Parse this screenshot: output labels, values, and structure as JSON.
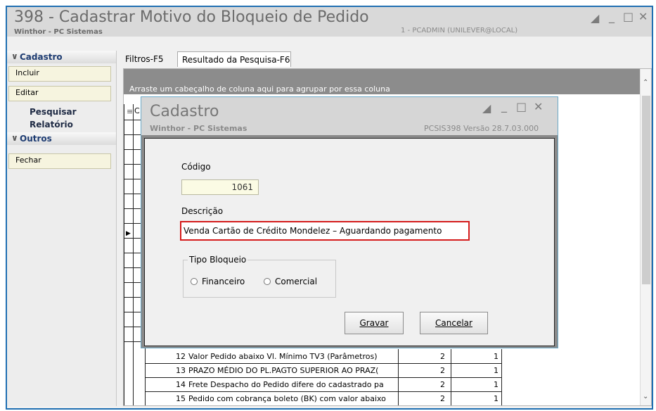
{
  "window": {
    "title": "398 - Cadastrar Motivo do Bloqueio de Pedido",
    "subtitle": "Winthor - PC Sistemas",
    "user_info": "1 - PCADMIN (UNILEVER@LOCAL)"
  },
  "sidebar": {
    "cadastro_header": "Cadastro",
    "incluir": "Incluir",
    "editar": "Editar",
    "pesquisar": "Pesquisar",
    "relatorio": "Relatório",
    "outros_header": "Outros",
    "fechar": "Fechar"
  },
  "tabs": {
    "filtros": "Filtros-F5",
    "resultado": "Resultado da Pesquisa-F6"
  },
  "grid": {
    "group_hint": "Arraste um cabeçalho de coluna aqui para agrupar por essa coluna",
    "rows": [
      {
        "code": "12",
        "desc": "Valor Pedido abaixo Vl. Mínimo TV3 (Parâmetros)",
        "col3": "2",
        "col4": "1"
      },
      {
        "code": "13",
        "desc": "PRAZO MÉDIO DO PL.PAGTO SUPERIOR AO PRAZ(",
        "col3": "2",
        "col4": "1"
      },
      {
        "code": "14",
        "desc": "Frete Despacho do Pedido difere do cadastrado pa",
        "col3": "2",
        "col4": "1"
      },
      {
        "code": "15",
        "desc": "Pedido com cobrança boleto (BK) com valor abaixo",
        "col3": "2",
        "col4": "1"
      }
    ]
  },
  "dialog": {
    "title": "Cadastro",
    "subtitle": "Winthor - PC Sistemas",
    "version": "PCSIS398  Versão  28.7.03.000",
    "codigo_label": "Código",
    "codigo_value": "1061",
    "descricao_label": "Descrição",
    "descricao_value": "Venda Cartão de Crédito Mondelez – Aguardando pagamento",
    "tipo_label": "Tipo Bloqueio",
    "tipo_options": [
      "Financeiro",
      "Comercial"
    ],
    "gravar": "Gravar",
    "cancelar": "Cancelar"
  },
  "colors": {
    "window_border": "#1f6fb2",
    "highlight_border": "#d51c1c",
    "readonly_field": "#fbfbe4"
  },
  "icons": [
    "restore-icon",
    "minimize-icon",
    "maximize-icon",
    "close-icon",
    "chevron-down-icon",
    "scroll-up-icon",
    "scroll-down-icon",
    "row-indicator-icon"
  ]
}
